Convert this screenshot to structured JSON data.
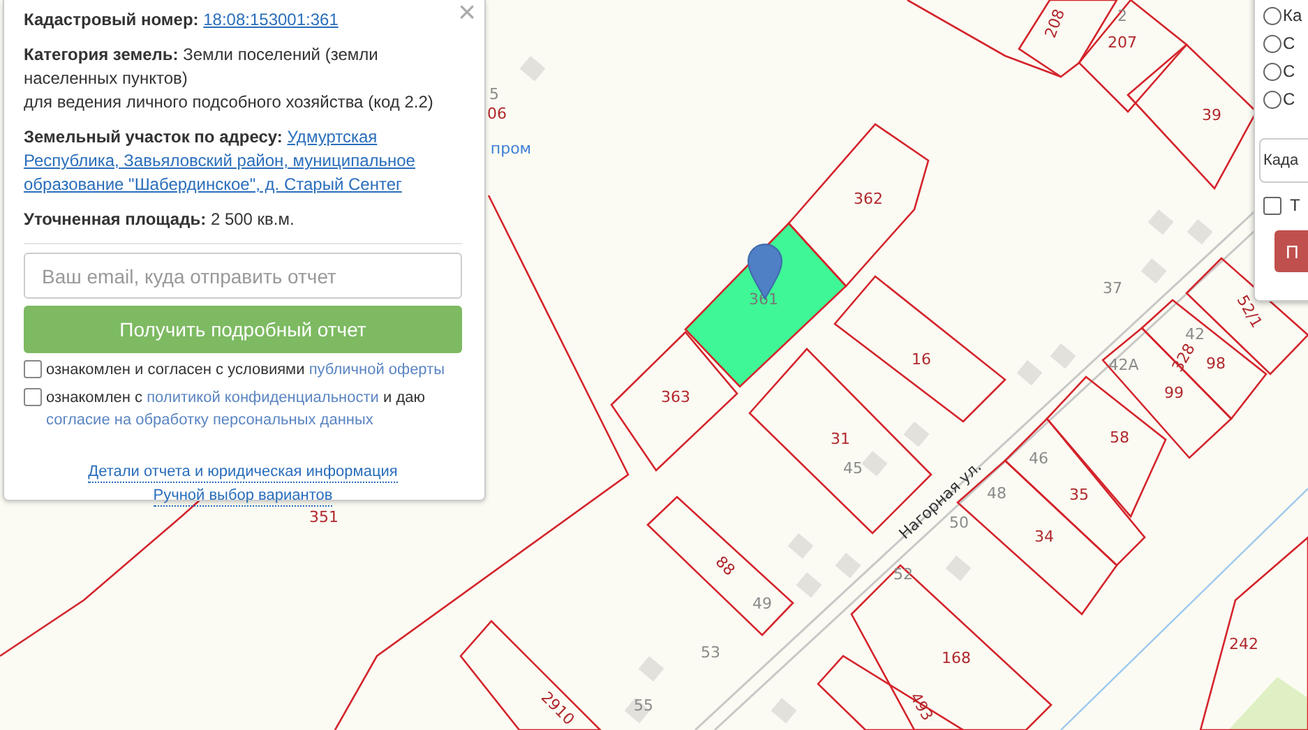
{
  "info_panel": {
    "close": "×",
    "fields": [
      {
        "label": "Кадастровый номер:",
        "value": "18:08:153001:361",
        "kind": "link"
      },
      {
        "label": "Категория земель:",
        "value": "Земли поселений (земли населенных пунктов)",
        "note": "для ведения личного подсобного хозяйства (код 2.2)",
        "kind": "text"
      },
      {
        "label": "Земельный участок по адресу:",
        "value": "Удмуртская Республика, Завьяловский район, муниципальное образование \"Шабердинское\", д. Старый Сентег",
        "kind": "link"
      },
      {
        "label": "Уточненная площадь:",
        "value": "2 500 кв.м.",
        "kind": "text"
      }
    ],
    "email_field": {
      "placeholder": "Ваш email, куда отправить отчет"
    },
    "submit_button": "Получить подробный отчет",
    "agreements": [
      {
        "checked": false,
        "parts": [
          {
            "text": "ознакомлен и согласен с условиями",
            "kind": "text"
          },
          {
            "text": "публичной оферты",
            "kind": "link"
          }
        ]
      },
      {
        "checked": false,
        "parts": [
          {
            "text": "ознакомлен с",
            "kind": "text"
          },
          {
            "text": "политикой конфиденциальности",
            "kind": "link"
          },
          {
            "text": "и даю",
            "kind": "text"
          },
          {
            "text": "согласие на обработку персональных данных",
            "kind": "link"
          }
        ]
      }
    ],
    "links": [
      "Детали отчета и юридическая информация",
      "Ручной выбор вариантов"
    ]
  },
  "side_panel": {
    "options": [
      {
        "label": "Ка",
        "selected": false
      },
      {
        "label": "С",
        "selected": false
      },
      {
        "label": "С",
        "selected": false
      },
      {
        "label": "С",
        "selected": false
      }
    ],
    "field_value": "Када",
    "checkbox": {
      "label": "Т",
      "checked": false
    },
    "button": "П"
  },
  "map": {
    "street": "Нагорная ул.",
    "parcels": [
      {
        "number": "362",
        "selected": false
      },
      {
        "number": "361",
        "selected": true
      },
      {
        "number": "363",
        "selected": false
      },
      {
        "number": "16",
        "selected": false
      },
      {
        "number": "31",
        "selected": false
      },
      {
        "number": "88",
        "selected": false
      },
      {
        "number": "168",
        "selected": false
      },
      {
        "number": "493",
        "selected": false
      },
      {
        "number": "2910",
        "selected": false
      },
      {
        "number": "34",
        "selected": false
      },
      {
        "number": "35",
        "selected": false
      },
      {
        "number": "58",
        "selected": false
      },
      {
        "number": "99",
        "selected": false
      },
      {
        "number": "98",
        "selected": false
      },
      {
        "number": "52/1",
        "selected": false
      },
      {
        "number": "39",
        "selected": false
      },
      {
        "number": "207",
        "selected": false
      },
      {
        "number": "208",
        "selected": false
      },
      {
        "number": "242",
        "selected": false
      }
    ],
    "labels": [
      {
        "text": "328",
        "kind": "parcel"
      },
      {
        "text": "351",
        "kind": "parcel"
      },
      {
        "text": "2",
        "kind": "building"
      },
      {
        "text": "37",
        "kind": "building"
      },
      {
        "text": "42А",
        "kind": "building"
      },
      {
        "text": "45",
        "kind": "building"
      },
      {
        "text": "46",
        "kind": "building"
      },
      {
        "text": "48",
        "kind": "building"
      },
      {
        "text": "50",
        "kind": "building"
      },
      {
        "text": "52",
        "kind": "building"
      },
      {
        "text": "53",
        "kind": "building"
      },
      {
        "text": "55",
        "kind": "building"
      },
      {
        "text": "49",
        "kind": "building"
      },
      {
        "text": "42",
        "kind": "building"
      },
      {
        "text": "5",
        "kind": "building"
      },
      {
        "text": "06",
        "kind": "parcel"
      },
      {
        "text": "пром",
        "kind": "poi"
      }
    ]
  }
}
